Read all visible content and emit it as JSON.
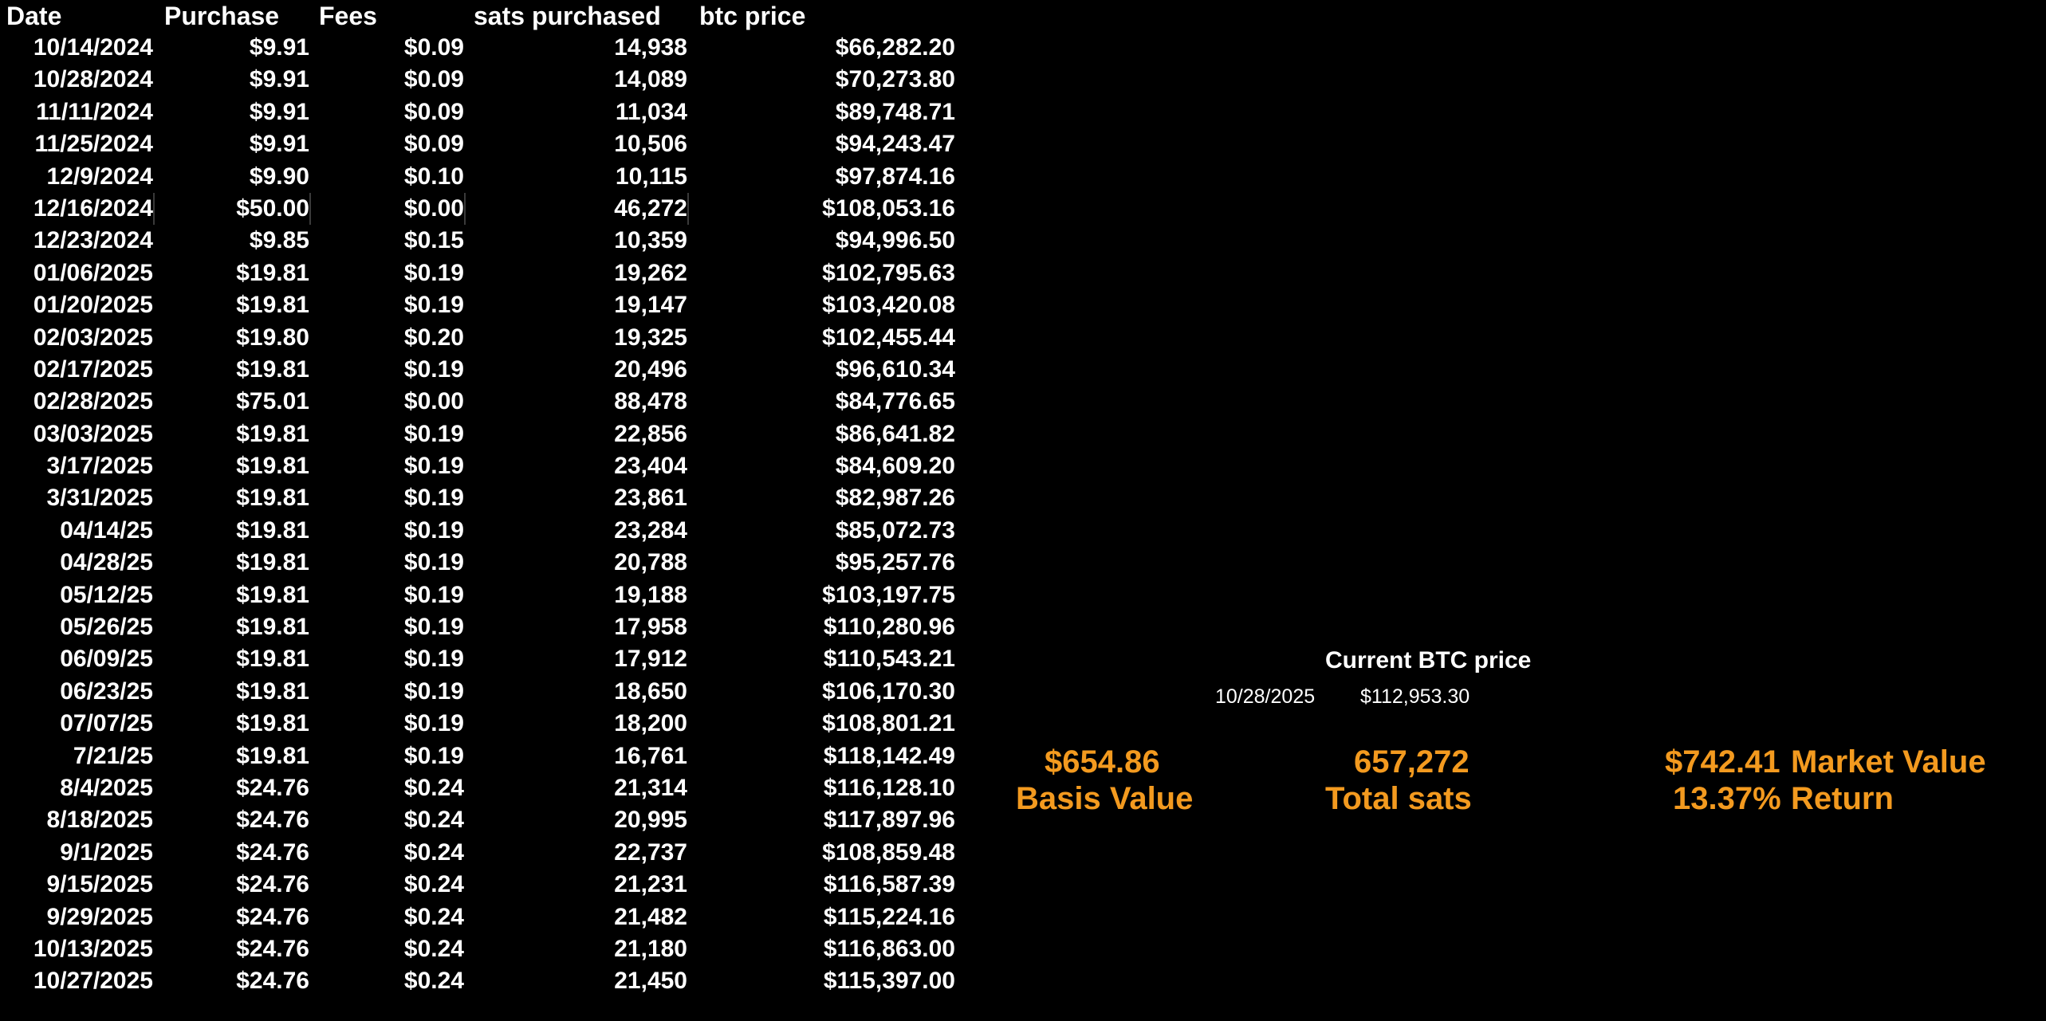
{
  "headers": {
    "date": "Date",
    "purchase": "Purchase",
    "fees": "Fees",
    "sats": "sats purchased",
    "price": "btc price"
  },
  "rows": [
    {
      "date": "10/14/2024",
      "purchase": "$9.91",
      "fees": "$0.09",
      "sats": "14,938",
      "price": "$66,282.20"
    },
    {
      "date": "10/28/2024",
      "purchase": "$9.91",
      "fees": "$0.09",
      "sats": "14,089",
      "price": "$70,273.80"
    },
    {
      "date": "11/11/2024",
      "purchase": "$9.91",
      "fees": "$0.09",
      "sats": "11,034",
      "price": "$89,748.71"
    },
    {
      "date": "11/25/2024",
      "purchase": "$9.91",
      "fees": "$0.09",
      "sats": "10,506",
      "price": "$94,243.47"
    },
    {
      "date": "12/9/2024",
      "purchase": "$9.90",
      "fees": "$0.10",
      "sats": "10,115",
      "price": "$97,874.16"
    },
    {
      "date": "12/16/2024",
      "purchase": "$50.00",
      "fees": "$0.00",
      "sats": "46,272",
      "price": "$108,053.16",
      "selected": true
    },
    {
      "date": "12/23/2024",
      "purchase": "$9.85",
      "fees": "$0.15",
      "sats": "10,359",
      "price": "$94,996.50"
    },
    {
      "date": "01/06/2025",
      "purchase": "$19.81",
      "fees": "$0.19",
      "sats": "19,262",
      "price": "$102,795.63"
    },
    {
      "date": "01/20/2025",
      "purchase": "$19.81",
      "fees": "$0.19",
      "sats": "19,147",
      "price": "$103,420.08"
    },
    {
      "date": "02/03/2025",
      "purchase": "$19.80",
      "fees": "$0.20",
      "sats": "19,325",
      "price": "$102,455.44"
    },
    {
      "date": "02/17/2025",
      "purchase": "$19.81",
      "fees": "$0.19",
      "sats": "20,496",
      "price": "$96,610.34"
    },
    {
      "date": "02/28/2025",
      "purchase": "$75.01",
      "fees": "$0.00",
      "sats": "88,478",
      "price": "$84,776.65"
    },
    {
      "date": "03/03/2025",
      "purchase": "$19.81",
      "fees": "$0.19",
      "sats": "22,856",
      "price": "$86,641.82"
    },
    {
      "date": "3/17/2025",
      "purchase": "$19.81",
      "fees": "$0.19",
      "sats": "23,404",
      "price": "$84,609.20"
    },
    {
      "date": "3/31/2025",
      "purchase": "$19.81",
      "fees": "$0.19",
      "sats": "23,861",
      "price": "$82,987.26"
    },
    {
      "date": "04/14/25",
      "purchase": "$19.81",
      "fees": "$0.19",
      "sats": "23,284",
      "price": "$85,072.73"
    },
    {
      "date": "04/28/25",
      "purchase": "$19.81",
      "fees": "$0.19",
      "sats": "20,788",
      "price": "$95,257.76"
    },
    {
      "date": "05/12/25",
      "purchase": "$19.81",
      "fees": "$0.19",
      "sats": "19,188",
      "price": "$103,197.75"
    },
    {
      "date": "05/26/25",
      "purchase": "$19.81",
      "fees": "$0.19",
      "sats": "17,958",
      "price": "$110,280.96"
    },
    {
      "date": "06/09/25",
      "purchase": "$19.81",
      "fees": "$0.19",
      "sats": "17,912",
      "price": "$110,543.21"
    },
    {
      "date": "06/23/25",
      "purchase": "$19.81",
      "fees": "$0.19",
      "sats": "18,650",
      "price": "$106,170.30"
    },
    {
      "date": "07/07/25",
      "purchase": "$19.81",
      "fees": "$0.19",
      "sats": "18,200",
      "price": "$108,801.21"
    },
    {
      "date": "7/21/25",
      "purchase": "$19.81",
      "fees": "$0.19",
      "sats": "16,761",
      "price": "$118,142.49"
    },
    {
      "date": "8/4/2025",
      "purchase": "$24.76",
      "fees": "$0.24",
      "sats": "21,314",
      "price": "$116,128.10"
    },
    {
      "date": "8/18/2025",
      "purchase": "$24.76",
      "fees": "$0.24",
      "sats": "20,995",
      "price": "$117,897.96"
    },
    {
      "date": "9/1/2025",
      "purchase": "$24.76",
      "fees": "$0.24",
      "sats": "22,737",
      "price": "$108,859.48"
    },
    {
      "date": "9/15/2025",
      "purchase": "$24.76",
      "fees": "$0.24",
      "sats": "21,231",
      "price": "$116,587.39"
    },
    {
      "date": "9/29/2025",
      "purchase": "$24.76",
      "fees": "$0.24",
      "sats": "21,482",
      "price": "$115,224.16"
    },
    {
      "date": "10/13/2025",
      "purchase": "$24.76",
      "fees": "$0.24",
      "sats": "21,180",
      "price": "$116,863.00"
    },
    {
      "date": "10/27/2025",
      "purchase": "$24.76",
      "fees": "$0.24",
      "sats": "21,450",
      "price": "$115,397.00"
    }
  ],
  "current": {
    "header": "Current BTC price",
    "date": "10/28/2025",
    "price": "$112,953.30"
  },
  "summary": {
    "basis_value": "$654.86",
    "basis_label": "Basis Value",
    "total_sats": "657,272",
    "total_sats_label": "Total sats",
    "market_value": "$742.41",
    "market_value_label": "Market Value",
    "return_value": "13.37%",
    "return_label": "Return"
  },
  "colors": {
    "background": "#000000",
    "text": "#ffffff",
    "accent": "#f39a1f"
  }
}
